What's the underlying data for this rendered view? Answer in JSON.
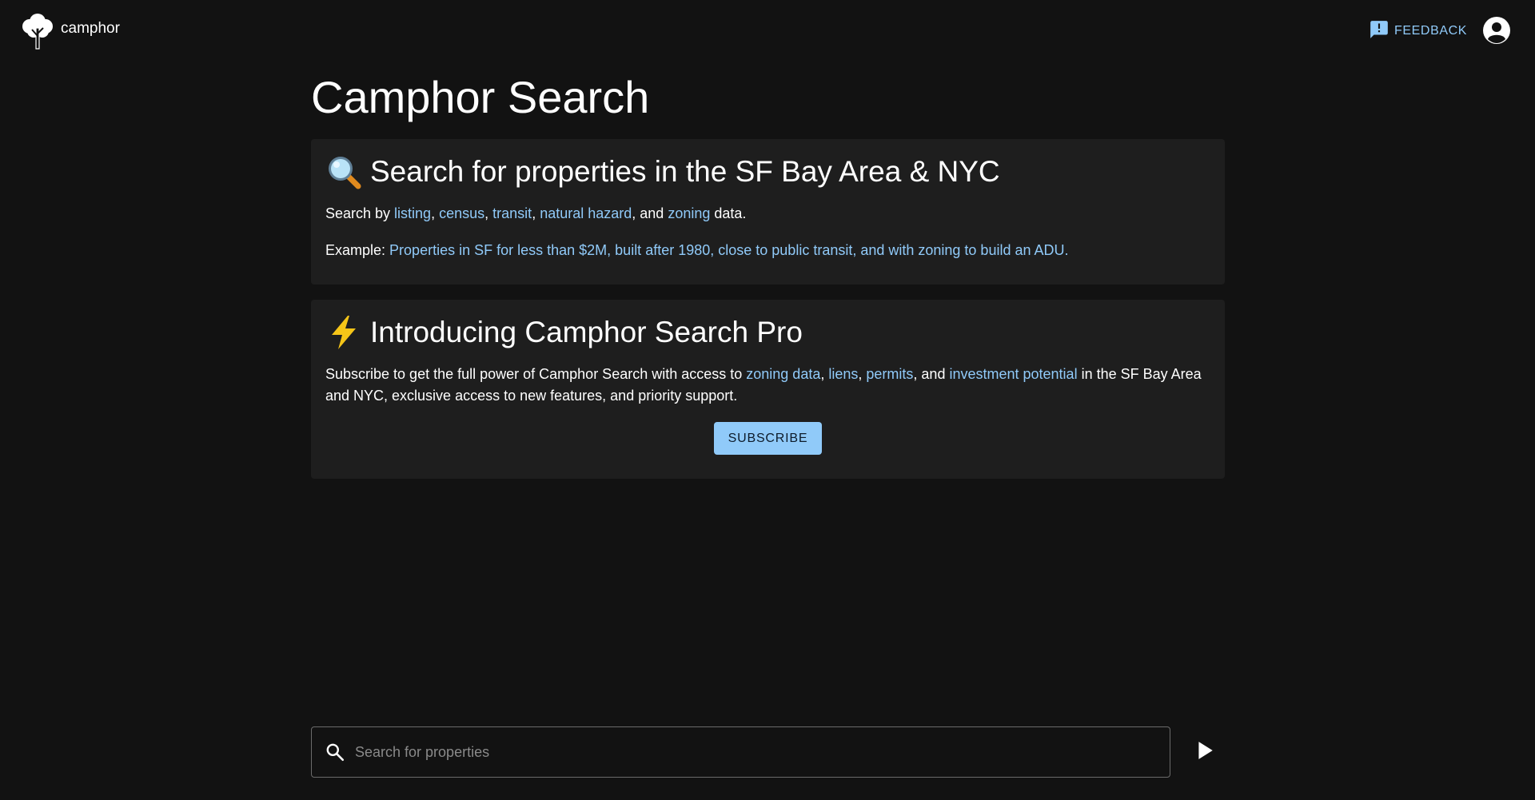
{
  "header": {
    "brand_name": "camphor",
    "feedback_label": "FEEDBACK"
  },
  "main": {
    "title": "Camphor Search",
    "search_card": {
      "heading": "Search for properties in the SF Bay Area & NYC",
      "intro_prefix": "Search by ",
      "links": [
        "listing",
        "census",
        "transit",
        "natural hazard",
        "zoning"
      ],
      "sep_comma": ", ",
      "sep_and": ", and ",
      "intro_suffix": " data.",
      "example_label": "Example: ",
      "example_link": "Properties in SF for less than $2M, built after 1980, close to public transit, and with zoning to build an ADU."
    },
    "pro_card": {
      "heading": "Introducing Camphor Search Pro",
      "text_prefix": "Subscribe to get the full power of Camphor Search with access to ",
      "links": [
        "zoning data",
        "liens",
        "permits",
        "investment potential"
      ],
      "sep_comma": ", ",
      "sep_and": ", and ",
      "text_suffix": " in the SF Bay Area and NYC, exclusive access to new features, and priority support.",
      "subscribe_label": "SUBSCRIBE"
    }
  },
  "search": {
    "placeholder": "Search for properties",
    "value": ""
  },
  "icons": {
    "logo": "tree-logo-icon",
    "feedback": "feedback-icon",
    "account": "account-circle-icon",
    "search_heading": "magnifying-glass-emoji-icon",
    "pro_heading": "lightning-emoji-icon",
    "search_field": "search-icon",
    "send": "send-arrow-icon"
  },
  "colors": {
    "background": "#121212",
    "card": "#1e1e1e",
    "accent": "#90caf9",
    "text": "#ffffff"
  }
}
